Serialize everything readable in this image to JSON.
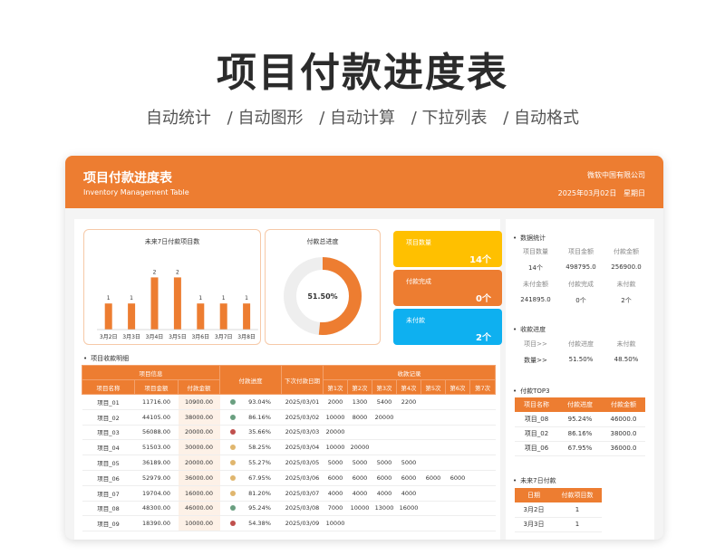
{
  "page": {
    "title": "项目付款进度表",
    "features": [
      "自动统计",
      "/ 自动图形",
      "/ 自动计算",
      "/ 下拉列表",
      "/ 自动格式"
    ]
  },
  "header": {
    "title": "项目付款进度表",
    "subtitle": "Inventory Management Table",
    "company": "微软中国有限公司",
    "date": "2025年03月02日",
    "weekday": "星期日"
  },
  "colors": {
    "accent": "#ed7d31",
    "yellow": "#ffc000",
    "blue": "#0eb0f0",
    "green": "#6a9f80",
    "red": "#c0504d",
    "tan": "#e0b66e"
  },
  "chart_data": {
    "type": "bar",
    "title": "未来7日付款项目数",
    "categories": [
      "3月2日",
      "3月3日",
      "3月4日",
      "3月5日",
      "3月6日",
      "3月7日",
      "3月8日"
    ],
    "values": [
      1,
      1,
      2,
      2,
      1,
      1,
      1
    ],
    "ylim": [
      0,
      2.5
    ]
  },
  "donut": {
    "title": "付款总进度",
    "percent": 51.5,
    "label": "51.50%"
  },
  "kpis": [
    {
      "label": "项目数量",
      "value": "14个",
      "color": "#ffc000"
    },
    {
      "label": "付款完成",
      "value": "0个",
      "color": "#ed7d31"
    },
    {
      "label": "未付款",
      "value": "2个",
      "color": "#0eb0f0"
    }
  ],
  "detail": {
    "section": "项目收款明细",
    "group_headers": {
      "info": "项目信息",
      "progress": "付款进度",
      "next": "下次付款日期",
      "records": "收款记录"
    },
    "columns": [
      "项目名称",
      "项目金额",
      "付款金额",
      "第1次",
      "第2次",
      "第3次",
      "第4次",
      "第5次",
      "第6次",
      "第7次"
    ],
    "rows": [
      {
        "name": "项目_01",
        "amount": "11716.00",
        "paid": "10900.00",
        "pct": "93.04%",
        "frac": 0.9304,
        "dot": "#6a9f80",
        "date": "2025/03/01",
        "r": [
          "2000",
          "1300",
          "5400",
          "2200",
          "",
          "",
          ""
        ]
      },
      {
        "name": "项目_02",
        "amount": "44105.00",
        "paid": "38000.00",
        "pct": "86.16%",
        "frac": 0.8616,
        "dot": "#6a9f80",
        "date": "2025/03/02",
        "r": [
          "10000",
          "8000",
          "20000",
          "",
          "",
          "",
          ""
        ]
      },
      {
        "name": "项目_03",
        "amount": "56088.00",
        "paid": "20000.00",
        "pct": "35.66%",
        "frac": 0.3566,
        "dot": "#c0504d",
        "date": "2025/03/03",
        "r": [
          "20000",
          "",
          "",
          "",
          "",
          "",
          ""
        ]
      },
      {
        "name": "项目_04",
        "amount": "51503.00",
        "paid": "30000.00",
        "pct": "58.25%",
        "frac": 0.5825,
        "dot": "#e0b66e",
        "date": "2025/03/04",
        "r": [
          "10000",
          "20000",
          "",
          "",
          "",
          "",
          ""
        ]
      },
      {
        "name": "项目_05",
        "amount": "36189.00",
        "paid": "20000.00",
        "pct": "55.27%",
        "frac": 0.5527,
        "dot": "#e0b66e",
        "date": "2025/03/05",
        "r": [
          "5000",
          "5000",
          "5000",
          "5000",
          "",
          "",
          ""
        ]
      },
      {
        "name": "项目_06",
        "amount": "52979.00",
        "paid": "36000.00",
        "pct": "67.95%",
        "frac": 0.6795,
        "dot": "#e0b66e",
        "date": "2025/03/06",
        "r": [
          "6000",
          "6000",
          "6000",
          "6000",
          "6000",
          "6000",
          ""
        ]
      },
      {
        "name": "项目_07",
        "amount": "19704.00",
        "paid": "16000.00",
        "pct": "81.20%",
        "frac": 0.812,
        "dot": "#e0b66e",
        "date": "2025/03/07",
        "r": [
          "4000",
          "4000",
          "4000",
          "4000",
          "",
          "",
          ""
        ]
      },
      {
        "name": "项目_08",
        "amount": "48300.00",
        "paid": "46000.00",
        "pct": "95.24%",
        "frac": 0.9524,
        "dot": "#6a9f80",
        "date": "2025/03/08",
        "r": [
          "7000",
          "10000",
          "13000",
          "16000",
          "",
          "",
          ""
        ]
      },
      {
        "name": "项目_09",
        "amount": "18390.00",
        "paid": "10000.00",
        "pct": "54.38%",
        "frac": 0.5438,
        "dot": "#c0504d",
        "date": "2025/03/09",
        "r": [
          "10000",
          "",
          "",
          "",
          "",
          "",
          ""
        ]
      }
    ]
  },
  "side": {
    "stats": {
      "section": "数据统计",
      "row1_labels": [
        "项目数量",
        "项目金额",
        "付款金额"
      ],
      "row1_values": [
        "14个",
        "498795.0",
        "256900.0"
      ],
      "row2_labels": [
        "未付金额",
        "付款完成",
        "未付款"
      ],
      "row2_values": [
        "241895.0",
        "0个",
        "2个"
      ]
    },
    "progress": {
      "section": "收款进度",
      "labels": [
        "项目>>",
        "付款进度",
        "未付款"
      ],
      "values": [
        "数量>>",
        "51.50%",
        "48.50%"
      ]
    },
    "top3": {
      "section": "付款TOP3",
      "columns": [
        "项目名称",
        "付款进度",
        "付款金额"
      ],
      "rows": [
        [
          "项目_08",
          "95.24%",
          "46000.0"
        ],
        [
          "项目_02",
          "86.16%",
          "38000.0"
        ],
        [
          "项目_06",
          "67.95%",
          "36000.0"
        ]
      ]
    },
    "next7": {
      "section": "未来7日付款",
      "columns": [
        "日期",
        "付款项目数"
      ],
      "rows": [
        [
          "3月2日",
          "1"
        ],
        [
          "3月3日",
          "1"
        ]
      ]
    }
  }
}
